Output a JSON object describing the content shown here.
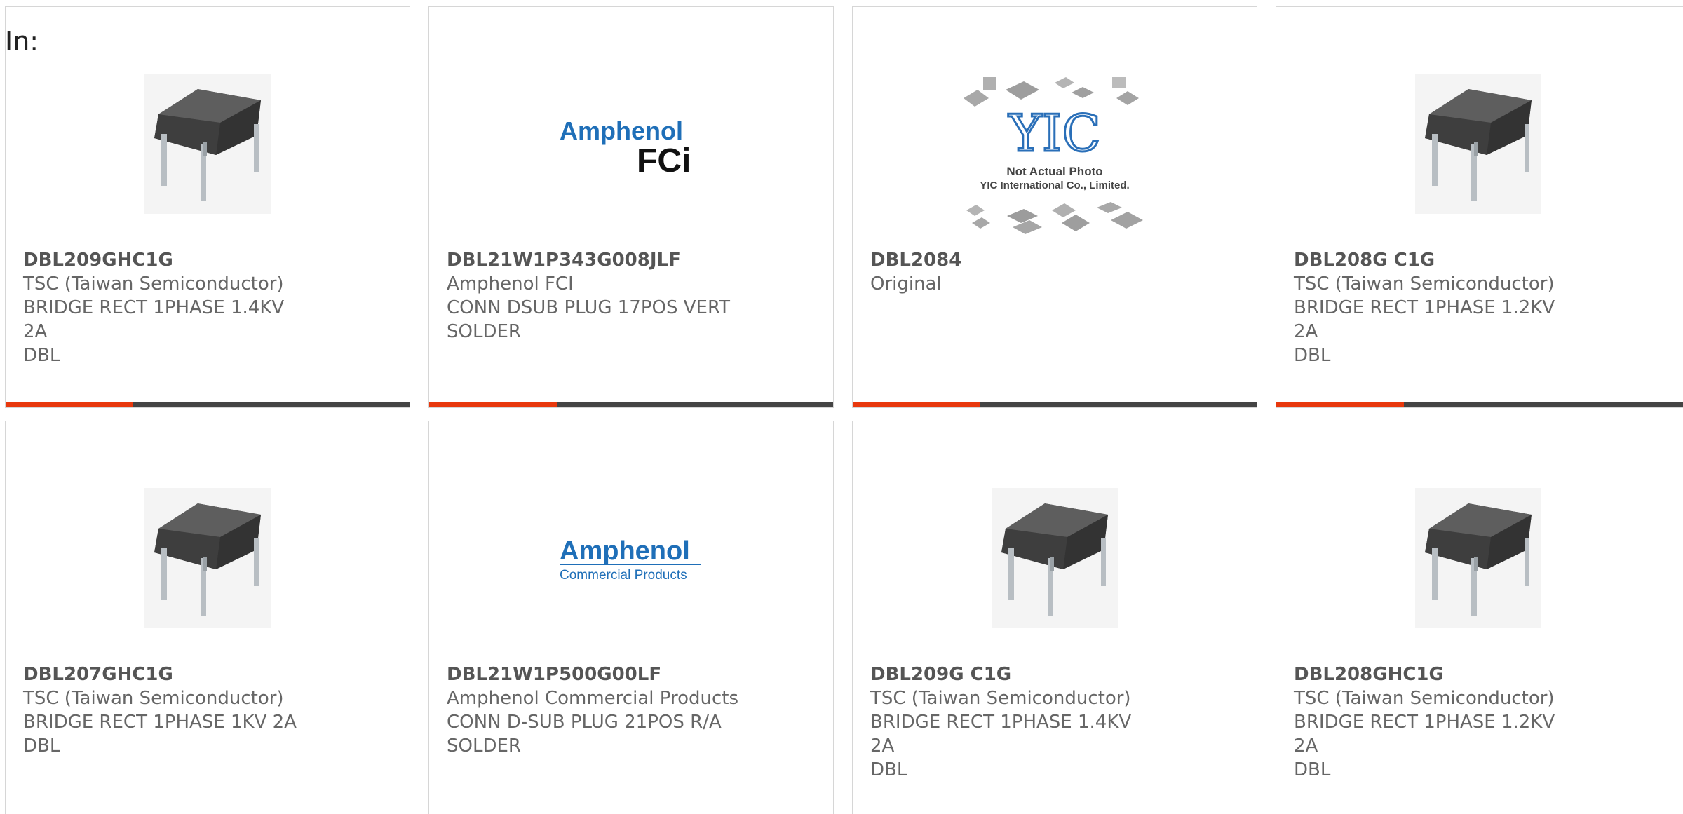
{
  "header": {
    "filter_label": "In:"
  },
  "brand": {
    "accent_color": "#e8380d",
    "bar_color": "#444444",
    "amphenol_blue": "#1f6fb8"
  },
  "products": [
    {
      "part_number": "DBL209GHC1G",
      "manufacturer": "TSC (Taiwan Semiconductor)",
      "description": "BRIDGE RECT 1PHASE 1.4KV 2A",
      "package": "DBL",
      "image": "bridge-rectifier-photo"
    },
    {
      "part_number": "DBL21W1P343G008JLF",
      "manufacturer": "Amphenol FCI",
      "description": "CONN DSUB PLUG 17POS VERT SOLDER",
      "package": "",
      "image": "amphenol-fci-logo",
      "logo_line1": "Amphenol",
      "logo_line2": "FCi"
    },
    {
      "part_number": "DBL2084",
      "manufacturer": "Original",
      "description": "",
      "package": "",
      "image": "yic-placeholder",
      "logo_mark": "YIC",
      "placeholder_line1": "Not Actual Photo",
      "placeholder_line2": "YIC International Co., Limited."
    },
    {
      "part_number": "DBL208G C1G",
      "manufacturer": "TSC (Taiwan Semiconductor)",
      "description": "BRIDGE RECT 1PHASE 1.2KV 2A",
      "package": "DBL",
      "image": "bridge-rectifier-photo"
    },
    {
      "part_number": "DBL207GHC1G",
      "manufacturer": "TSC (Taiwan Semiconductor)",
      "description": "BRIDGE RECT 1PHASE 1KV 2A",
      "package": "DBL",
      "image": "bridge-rectifier-photo"
    },
    {
      "part_number": "DBL21W1P500G00LF",
      "manufacturer": "Amphenol Commercial Products",
      "description": "CONN D-SUB PLUG 21POS R/A SOLDER",
      "package": "",
      "image": "amphenol-commercial-logo",
      "logo_line1": "Amphenol",
      "logo_line2": "Commercial Products"
    },
    {
      "part_number": "DBL209G C1G",
      "manufacturer": "TSC (Taiwan Semiconductor)",
      "description": "BRIDGE RECT 1PHASE 1.4KV 2A",
      "package": "DBL",
      "image": "bridge-rectifier-photo"
    },
    {
      "part_number": "DBL208GHC1G",
      "manufacturer": "TSC (Taiwan Semiconductor)",
      "description": "BRIDGE RECT 1PHASE 1.2KV 2A",
      "package": "DBL",
      "image": "bridge-rectifier-photo"
    }
  ]
}
